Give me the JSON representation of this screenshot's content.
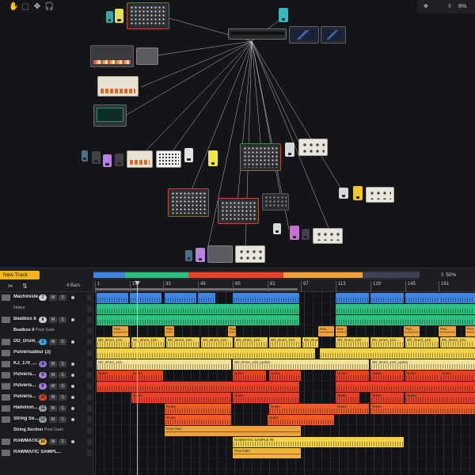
{
  "toolbar": {
    "icons": [
      "hand-icon",
      "select-icon",
      "move-icon",
      "headphones-icon"
    ],
    "zoom_value": "8%"
  },
  "strip": {
    "new_track_label": "New Track",
    "zoom_value": "50%"
  },
  "tracklist": {
    "bars_label": "4 Bars",
    "tracks": [
      {
        "name": "Machiniste",
        "badge": "7",
        "badge_color": "#c9ccd2",
        "m": "M",
        "s": "S",
        "type": "instrument"
      },
      {
        "sub": "Notes",
        "type": "lane"
      },
      {
        "name": "Beatbox 8",
        "badge": "8",
        "badge_color": "#c9ccd2",
        "m": "M",
        "s": "S",
        "type": "instrument"
      },
      {
        "parent": "Beatbox 9",
        "sub": "Post Gain",
        "type": "lane"
      },
      {
        "name": "DD_Drum_...",
        "badge": "2",
        "badge_color": "#3fa0e0",
        "m": "M",
        "s": "S",
        "type": "instrument"
      },
      {
        "name": "Pulverisateur (3)",
        "type": "instrument-wide"
      },
      {
        "name": "KJ_170_...",
        "badge": "4",
        "badge_color": "#8a6fd0",
        "m": "M",
        "s": "S",
        "type": "instrument"
      },
      {
        "name": "Pulveris...",
        "badge": "9",
        "badge_color": "#a77be0",
        "m": "M",
        "s": "S",
        "type": "instrument"
      },
      {
        "name": "Pulveris...",
        "badge": "8",
        "badge_color": "#a77be0",
        "m": "M",
        "s": "S",
        "type": "instrument"
      },
      {
        "name": "Pulveris...",
        "badge": "10",
        "badge_color": "#e5422a",
        "m": "M",
        "s": "S",
        "type": "instrument"
      },
      {
        "name": "Hammon...",
        "badge": "11",
        "badge_color": "#9aa0a8",
        "m": "M",
        "s": "S",
        "type": "instrument"
      },
      {
        "name": "String Se...",
        "badge": "12",
        "badge_color": "#9aa0a8",
        "m": "M",
        "s": "S",
        "type": "instrument"
      },
      {
        "parent": "String Section",
        "sub": "Post Gain",
        "type": "lane"
      },
      {
        "name": "RAWMATIC...",
        "badge": "16",
        "badge_color": "#f3b33a",
        "m": "M",
        "s": "S",
        "type": "instrument"
      },
      {
        "name": "RAWMATIC SAMPL...",
        "type": "instrument-wide"
      }
    ]
  },
  "ruler": {
    "labels": [
      "1",
      "17",
      "33",
      "49",
      "65",
      "81",
      "97",
      "113",
      "129",
      "145",
      "161"
    ]
  },
  "clips": {
    "notes": "Notes",
    "post_gain": "Post Gain",
    "pos": "Pos...",
    "dd_drum_short": "DD_Drum_122...",
    "dd_drum_long": "DD_Drum_122_Lp32a",
    "rawmatic": "RAWMATIC SAMPLE #9"
  },
  "colors": {
    "accent": "#f3b31a",
    "blue": "#3f86e3",
    "green": "#2fbf7f",
    "orange": "#f0a23a",
    "yellow": "#f1d34d",
    "red": "#e5422a"
  }
}
